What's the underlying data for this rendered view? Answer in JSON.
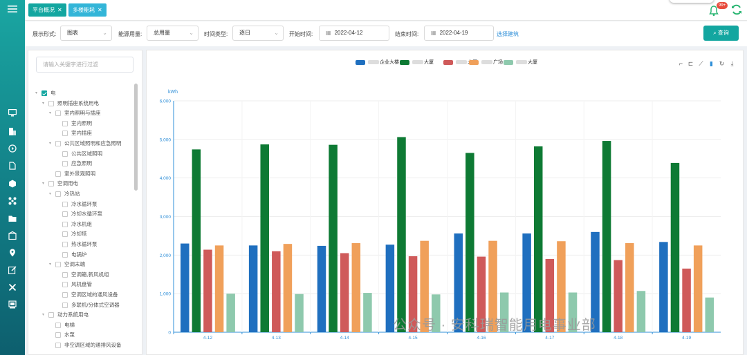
{
  "nav": {
    "icons": [
      "menu-icon",
      "monitor-icon",
      "building-icon",
      "play-circle-icon",
      "document-icon",
      "hexagon-icon",
      "network-icon",
      "folder-icon",
      "apartment-icon",
      "location-icon",
      "edit-icon",
      "tools-icon",
      "device-icon"
    ]
  },
  "tabs": [
    {
      "label": "平台概况",
      "color": "#13a6a0"
    },
    {
      "label": "多楼能耗",
      "color": "#33b5d8"
    }
  ],
  "notify": {
    "badge": "99+"
  },
  "filters": {
    "display_label": "展示形式:",
    "display_value": "图表",
    "energy_label": "能源用量:",
    "energy_value": "总用量",
    "time_type_label": "时间类型:",
    "time_type_value": "逐日",
    "start_label": "开始时间:",
    "start_value": "2022-04-12",
    "end_label": "结束时间:",
    "end_value": "2022-04-19",
    "select_building": "选择建筑",
    "query": "查询"
  },
  "tree": {
    "search_placeholder": "请输入关键字进行过滤",
    "items": [
      {
        "label": "电",
        "level": 0,
        "arrow": true,
        "checked": true
      },
      {
        "label": "照明插座系统用电",
        "level": 1,
        "arrow": true
      },
      {
        "label": "室内照明与插座",
        "level": 2,
        "arrow": true
      },
      {
        "label": "室内照明",
        "level": 3
      },
      {
        "label": "室内插座",
        "level": 3
      },
      {
        "label": "公共区域照明和应急照明",
        "level": 2,
        "arrow": true
      },
      {
        "label": "公共区域照明",
        "level": 3
      },
      {
        "label": "应急照明",
        "level": 3
      },
      {
        "label": "室外景观照明",
        "level": 2
      },
      {
        "label": "空调用电",
        "level": 1,
        "arrow": true
      },
      {
        "label": "冷热站",
        "level": 2,
        "arrow": true
      },
      {
        "label": "冷水循环泵",
        "level": 3
      },
      {
        "label": "冷却水循环泵",
        "level": 3
      },
      {
        "label": "冷水机组",
        "level": 3
      },
      {
        "label": "冷却塔",
        "level": 3
      },
      {
        "label": "热水循环泵",
        "level": 3
      },
      {
        "label": "电锅炉",
        "level": 3
      },
      {
        "label": "空调末端",
        "level": 2,
        "arrow": true
      },
      {
        "label": "空调箱,新风机组",
        "level": 3
      },
      {
        "label": "风机盘管",
        "level": 3
      },
      {
        "label": "空调区域的通风设备",
        "level": 3
      },
      {
        "label": "多联机/分体式空调器",
        "level": 3
      },
      {
        "label": "动力系统用电",
        "level": 1,
        "arrow": true
      },
      {
        "label": "电梯",
        "level": 2
      },
      {
        "label": "水泵",
        "level": 2
      },
      {
        "label": "非空调区域的通排风设备",
        "level": 2
      }
    ]
  },
  "legend": [
    {
      "name": "企业大楼",
      "color": "#1f6fbf"
    },
    {
      "name": "大厦",
      "color": "#0e7a34"
    },
    {
      "name": "大厦",
      "color": "#cf5a5a"
    },
    {
      "name": "广场",
      "color": "#f0a05a"
    },
    {
      "name": "大厦",
      "color": "#8ec9ad"
    }
  ],
  "toolbox": [
    "crop-icon",
    "crop-reset-icon",
    "line-chart-icon",
    "bar-chart-icon",
    "refresh-icon",
    "download-icon"
  ],
  "watermark": "公众号 · 安科瑞智能用电事业部",
  "chart_data": {
    "type": "bar",
    "ylabel": "kWh",
    "ylim": [
      0,
      6000
    ],
    "yticks": [
      "0",
      "1,000",
      "2,000",
      "3,000",
      "4,000",
      "5,000",
      "6,000"
    ],
    "categories": [
      "4-12",
      "4-13",
      "4-14",
      "4-15",
      "4-16",
      "4-17",
      "4-18",
      "4-19"
    ],
    "series": [
      {
        "name": "企业大楼",
        "color": "#1f6fbf",
        "values": [
          2300,
          2250,
          2240,
          2270,
          2560,
          2560,
          2600,
          2340
        ]
      },
      {
        "name": "大厦",
        "color": "#0e7a34",
        "values": [
          4740,
          4870,
          4860,
          5060,
          4650,
          4820,
          4960,
          4390
        ]
      },
      {
        "name": "大厦",
        "color": "#cf5a5a",
        "values": [
          2140,
          2100,
          2050,
          1970,
          1960,
          1900,
          1870,
          1650
        ]
      },
      {
        "name": "广场",
        "color": "#f0a05a",
        "values": [
          2250,
          2290,
          2310,
          2370,
          2370,
          2360,
          2310,
          2250
        ]
      },
      {
        "name": "大厦",
        "color": "#8ec9ad",
        "values": [
          1000,
          990,
          1020,
          980,
          1030,
          1030,
          1070,
          900
        ]
      }
    ]
  }
}
